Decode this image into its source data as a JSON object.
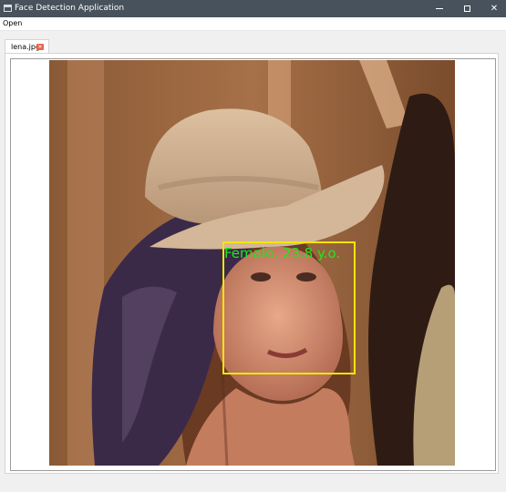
{
  "window": {
    "title": "Face Detection Application",
    "minimize": "",
    "maximize": "",
    "close": "✕"
  },
  "menu": {
    "items": [
      "Open"
    ]
  },
  "tabs": [
    {
      "label": "lena.jpg",
      "close": "✕"
    }
  ],
  "detection": {
    "label": "Female, 23.8 y.o.",
    "box_color": "#f2e600",
    "label_color": "#22e61a"
  }
}
